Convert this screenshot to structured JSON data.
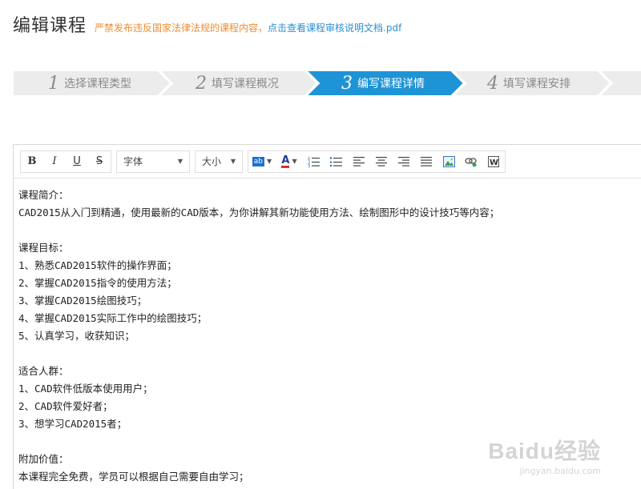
{
  "header": {
    "title": "编辑课程",
    "notice_warn": "严禁发布违反国家法律法规的课程内容，",
    "notice_link": "点击查看课程审核说明文档.pdf"
  },
  "steps": [
    {
      "num": "1",
      "label": "选择课程类型",
      "active": false
    },
    {
      "num": "2",
      "label": "填写课程概况",
      "active": false
    },
    {
      "num": "3",
      "label": "编写课程详情",
      "active": true
    },
    {
      "num": "4",
      "label": "填写课程安排",
      "active": false
    }
  ],
  "colors": {
    "step_inactive": "#ececec",
    "step_active": "#1e94d6",
    "step_separator": "#ffffff",
    "notice_warn": "#f08c2e",
    "notice_link": "#2a8fd6"
  },
  "toolbar": {
    "bold": "B",
    "italic": "I",
    "underline": "U",
    "strike": "S",
    "font_label": "字体",
    "size_label": "大小",
    "highlight_text": "ab",
    "font_color_text": "A",
    "word_text": "W"
  },
  "content_lines": [
    "课程简介：",
    "CAD2015从入门到精通，使用最新的CAD版本，为你讲解其新功能使用方法、绘制图形中的设计技巧等内容；",
    "",
    "课程目标：",
    "1、熟悉CAD2015软件的操作界面；",
    "2、掌握CAD2015指令的使用方法；",
    "3、掌握CAD2015绘图技巧；",
    "4、掌握CAD2015实际工作中的绘图技巧；",
    "5、认真学习，收获知识；",
    "",
    "适合人群：",
    "1、CAD软件低版本使用用户；",
    "2、CAD软件爱好者；",
    "3、想学习CAD2015者；",
    "",
    "附加价值：",
    "本课程完全免费，学员可以根据自己需要自由学习；"
  ],
  "watermark": {
    "logo": "Baidu经验",
    "url": "jingyan.baidu.com"
  }
}
